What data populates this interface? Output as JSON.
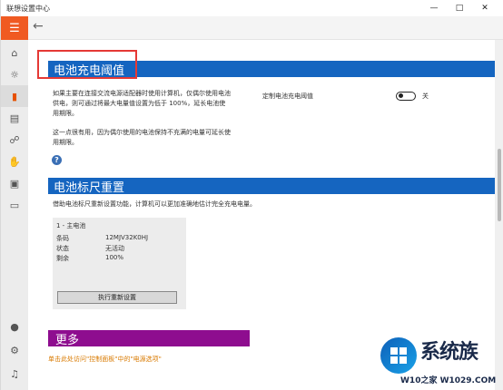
{
  "window": {
    "title": "联想设置中心",
    "min_icon": "minimize-icon",
    "max_icon": "maximize-icon",
    "close_icon": "close-icon"
  },
  "sidebar": {
    "menu_icon": "hamburger-icon",
    "items": [
      {
        "name": "home",
        "icon": "home-icon"
      },
      {
        "name": "display",
        "icon": "lightbulb-icon"
      },
      {
        "name": "battery",
        "icon": "battery-icon",
        "active": true
      },
      {
        "name": "audio",
        "icon": "audio-icon"
      },
      {
        "name": "network",
        "icon": "network-icon"
      },
      {
        "name": "input",
        "icon": "touchpad-icon"
      },
      {
        "name": "camera",
        "icon": "camera-icon"
      },
      {
        "name": "monitor",
        "icon": "monitor-icon"
      }
    ],
    "bottom": [
      {
        "name": "account",
        "icon": "user-icon"
      },
      {
        "name": "settings",
        "icon": "gear-icon"
      },
      {
        "name": "feedback",
        "icon": "megaphone-icon"
      }
    ]
  },
  "header": {
    "back_icon": "back-arrow-icon"
  },
  "threshold": {
    "title": "电池充电阈值",
    "desc_1": "如果主要在连接交流电源适配器时使用计算机，仅偶尔使用电池供电，则可通过将最大电量值设置为低于 100%，延长电池使用期限。",
    "desc_2": "这一点很有用，因为偶尔使用的电池保持不充满的电量可延长使用期限。",
    "toggle_label": "定制电池充电阈值",
    "toggle_state": "关",
    "help_icon": "help-icon"
  },
  "gauge": {
    "title": "电池标尺重置",
    "desc": "借助电池标尺重新设置功能，计算机可以更加准确地估计完全充电电量。",
    "card": {
      "heading": "1 - 主电池",
      "rows": [
        {
          "label": "条码",
          "value": "12MJV32K0HJ"
        },
        {
          "label": "状态",
          "value": "无活动"
        },
        {
          "label": "剩余",
          "value": "100%"
        }
      ],
      "button": "执行重新设置"
    }
  },
  "more": {
    "title": "更多",
    "link": "单击此处访问\"控制面板\"中的\"电源选项\""
  },
  "watermark": {
    "brand": "系统族",
    "site": "W10之家 W1029.COM"
  }
}
